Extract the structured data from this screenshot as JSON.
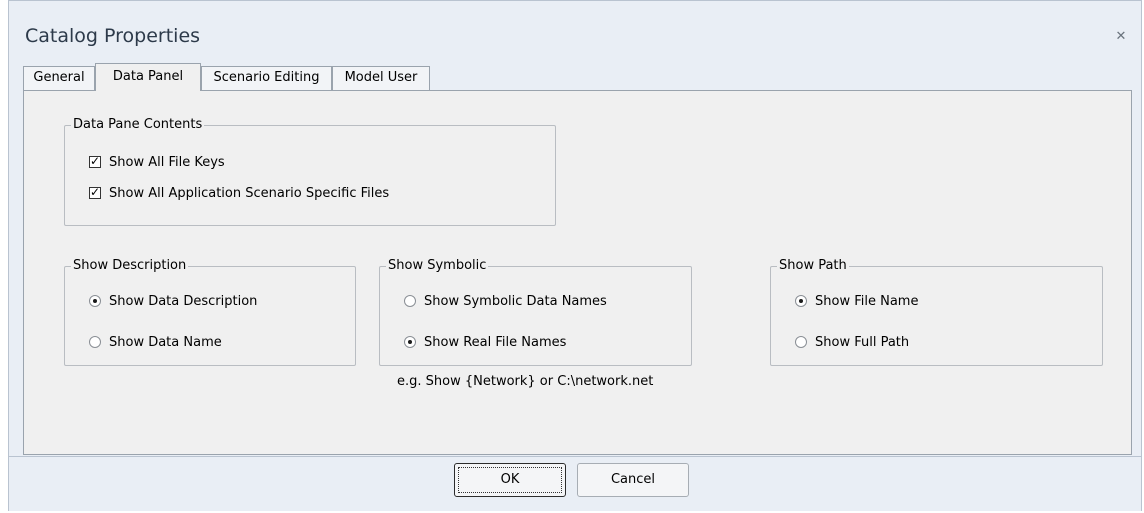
{
  "window": {
    "title": "Catalog Properties",
    "close_icon": "close-icon"
  },
  "tabs": [
    {
      "label": "General",
      "active": false
    },
    {
      "label": "Data Panel",
      "active": true
    },
    {
      "label": "Scenario Editing",
      "active": false
    },
    {
      "label": "Model User",
      "active": false
    }
  ],
  "data_pane_contents": {
    "title": "Data Pane Contents",
    "options": [
      {
        "label": "Show All File Keys",
        "checked": true
      },
      {
        "label": "Show All Application Scenario Specific Files",
        "checked": true
      }
    ]
  },
  "show_description": {
    "title": "Show Description",
    "options": [
      {
        "label": "Show Data Description",
        "selected": true
      },
      {
        "label": "Show Data Name",
        "selected": false
      }
    ]
  },
  "show_symbolic": {
    "title": "Show Symbolic",
    "options": [
      {
        "label": "Show Symbolic Data Names",
        "selected": false
      },
      {
        "label": "Show Real File Names",
        "selected": true
      }
    ],
    "note": "e.g. Show {Network} or C:\\network.net"
  },
  "show_path": {
    "title": "Show Path",
    "options": [
      {
        "label": "Show File Name",
        "selected": true
      },
      {
        "label": "Show Full Path",
        "selected": false
      }
    ]
  },
  "footer": {
    "ok_label": "OK",
    "cancel_label": "Cancel"
  }
}
